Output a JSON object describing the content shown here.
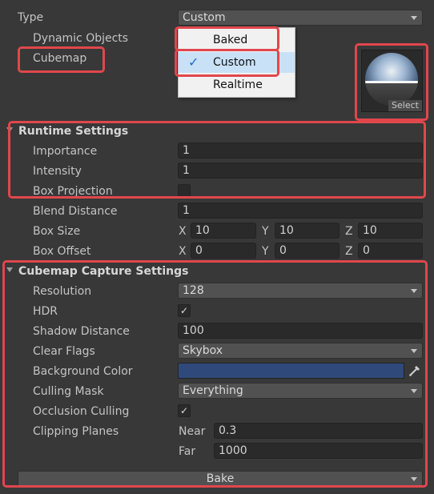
{
  "type": {
    "label": "Type",
    "value": "Custom"
  },
  "dynamic_objects": {
    "label": "Dynamic Objects"
  },
  "cubemap": {
    "label": "Cubemap",
    "select_label": "Select"
  },
  "type_menu": {
    "options": [
      "Baked",
      "Custom",
      "Realtime"
    ],
    "selected": "Custom"
  },
  "runtime": {
    "header": "Runtime Settings",
    "importance_label": "Importance",
    "importance_value": "1",
    "intensity_label": "Intensity",
    "intensity_value": "1",
    "box_projection_label": "Box Projection"
  },
  "blend_distance": {
    "label": "Blend Distance",
    "value": "1"
  },
  "box_size": {
    "label": "Box Size",
    "x": "10",
    "y": "10",
    "z": "10"
  },
  "box_offset": {
    "label": "Box Offset",
    "x": "0",
    "y": "0",
    "z": "0"
  },
  "axes": {
    "x": "X",
    "y": "Y",
    "z": "Z"
  },
  "capture": {
    "header": "Cubemap Capture Settings",
    "resolution_label": "Resolution",
    "resolution_value": "128",
    "hdr_label": "HDR",
    "hdr_checked": true,
    "shadow_distance_label": "Shadow Distance",
    "shadow_distance_value": "100",
    "clear_flags_label": "Clear Flags",
    "clear_flags_value": "Skybox",
    "background_color_label": "Background Color",
    "background_color_value": "#2f4a7a",
    "culling_mask_label": "Culling Mask",
    "culling_mask_value": "Everything",
    "occlusion_culling_label": "Occlusion Culling",
    "occlusion_culling_checked": true,
    "clipping_planes_label": "Clipping Planes",
    "near_label": "Near",
    "near_value": "0.3",
    "far_label": "Far",
    "far_value": "1000"
  },
  "bake": {
    "label": "Bake"
  },
  "highlight_color": "#e0474c",
  "check_glyph": "✓"
}
